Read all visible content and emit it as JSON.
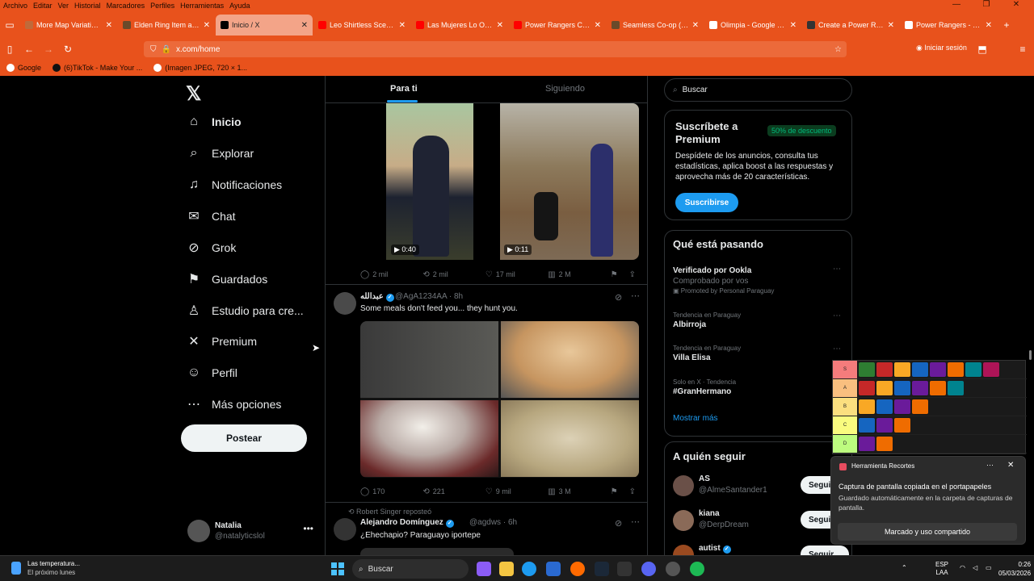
{
  "menubar": {
    "items": [
      "Archivo",
      "Editar",
      "Ver",
      "Historial",
      "Marcadores",
      "Perfiles",
      "Herramientas",
      "Ayuda"
    ]
  },
  "tabs": [
    {
      "title": "More Map Variations a",
      "color": "#c06a3a"
    },
    {
      "title": "Elden Ring Item and En",
      "color": "#6a4a2a"
    },
    {
      "title": "Inicio / X",
      "color": "#000000",
      "active": true
    },
    {
      "title": "Leo Shirtless Scene [Po",
      "color": "#ff0000"
    },
    {
      "title": "Las Mujeres Lo Odian C",
      "color": "#ff0000"
    },
    {
      "title": "Power Rangers Cosmic",
      "color": "#ff0000"
    },
    {
      "title": "Seamless Co-op (Elden",
      "color": "#6a4a2a"
    },
    {
      "title": "Olimpia - Google Searc",
      "color": "#ffffff"
    },
    {
      "title": "Create a Power Ranger",
      "color": "#333333"
    },
    {
      "title": "Power Rangers - Wikip",
      "color": "#ffffff"
    }
  ],
  "navbar": {
    "url": "x.com/home",
    "login_label": "Iniciar sesión"
  },
  "bookmarks": [
    "Google",
    "(6)TikTok - Make Your ...",
    "(Imagen JPEG, 720 × 1..."
  ],
  "sidebar": {
    "items": [
      {
        "label": "Inicio",
        "icon": "home-icon",
        "glyph": "⌂"
      },
      {
        "label": "Explorar",
        "icon": "search-icon",
        "glyph": "⌕"
      },
      {
        "label": "Notificaciones",
        "icon": "bell-icon",
        "glyph": "♫"
      },
      {
        "label": "Chat",
        "icon": "mail-icon",
        "glyph": "✉"
      },
      {
        "label": "Grok",
        "icon": "grok-icon",
        "glyph": "⊘"
      },
      {
        "label": "Guardados",
        "icon": "bookmark-icon",
        "glyph": "⚑"
      },
      {
        "label": "Estudio para cre...",
        "icon": "creator-studio-icon",
        "glyph": "♙"
      },
      {
        "label": "Premium",
        "icon": "x-premium-icon",
        "glyph": "✕"
      },
      {
        "label": "Perfil",
        "icon": "profile-icon",
        "glyph": "☺"
      },
      {
        "label": "Más opciones",
        "icon": "more-options-icon",
        "glyph": "⋯"
      }
    ],
    "post_label": "Postear",
    "user": {
      "name": "Natalia",
      "handle": "@natalyticslol"
    }
  },
  "feed": {
    "tab_for_you": "Para ti",
    "tab_following": "Siguiendo",
    "post1": {
      "video_a_duration": "0:40",
      "video_b_duration": "0:11",
      "replies": "2 mil",
      "reposts": "2 mil",
      "likes": "17 mil",
      "views": "2 M"
    },
    "post2": {
      "name": "عبدالله",
      "handle": "@AgA1234AA",
      "time": "· 8h",
      "text": "Some meals don't feed you... they hunt you.",
      "replies": "170",
      "reposts": "221",
      "likes": "9 mil",
      "views": "3 M"
    },
    "post3": {
      "repost_note": "Robert Singer reposteó",
      "name": "Alejandro Domínguez",
      "handle": "@agdws",
      "time": "· 6h",
      "text": "¿Ehechapio? Paraguayo iportepe"
    }
  },
  "right": {
    "search_placeholder": "Buscar",
    "premium": {
      "title": "Suscríbete a Premium",
      "badge": "50% de descuento",
      "text": "Despídete de los anuncios, consulta tus estadísticas, aplica boost a las respuestas y aprovecha más de 20 características.",
      "button": "Suscribirse"
    },
    "trending": {
      "title": "Qué está pasando",
      "items": [
        {
          "name": "Verificado por Ookla",
          "sub": "Comprobado por vos",
          "promo": "Promoted by Personal Paraguay"
        },
        {
          "context": "Tendencia en Paraguay",
          "name": "Albirroja"
        },
        {
          "context": "Tendencia en Paraguay",
          "name": "Villa Elisa"
        },
        {
          "context": "Solo en X · Tendencia",
          "name": "#GranHermano"
        }
      ],
      "show_more": "Mostrar más"
    },
    "follow": {
      "title": "A quién seguir",
      "users": [
        {
          "name": "AS",
          "handle": "@AlmeSantander1",
          "button": "Seguir"
        },
        {
          "name": "kiana",
          "handle": "@DerpDream",
          "button": "Seguir"
        },
        {
          "name": "autist",
          "handle": "",
          "button": "Seguir"
        }
      ]
    }
  },
  "tierlist": {
    "tiers": [
      {
        "label": "S",
        "color": "#f47c7c"
      },
      {
        "label": "A",
        "color": "#f9bf7f"
      },
      {
        "label": "B",
        "color": "#fbdf7f"
      },
      {
        "label": "C",
        "color": "#f9fb7f"
      },
      {
        "label": "D",
        "color": "#bdfb7f"
      }
    ]
  },
  "toast": {
    "app": "Herramienta Recortes",
    "message": "Captura de pantalla copiada en el portapapeles",
    "sub": "Guardado automáticamente en la carpeta de capturas de pantalla.",
    "button": "Marcado y uso compartido"
  },
  "taskbar": {
    "weather_title": "Las temperatura...",
    "weather_sub": "El próximo lunes",
    "search": "Buscar",
    "lang": "ESP",
    "lang_sub": "LAA",
    "time": "0:26",
    "date": "05/03/2026"
  }
}
